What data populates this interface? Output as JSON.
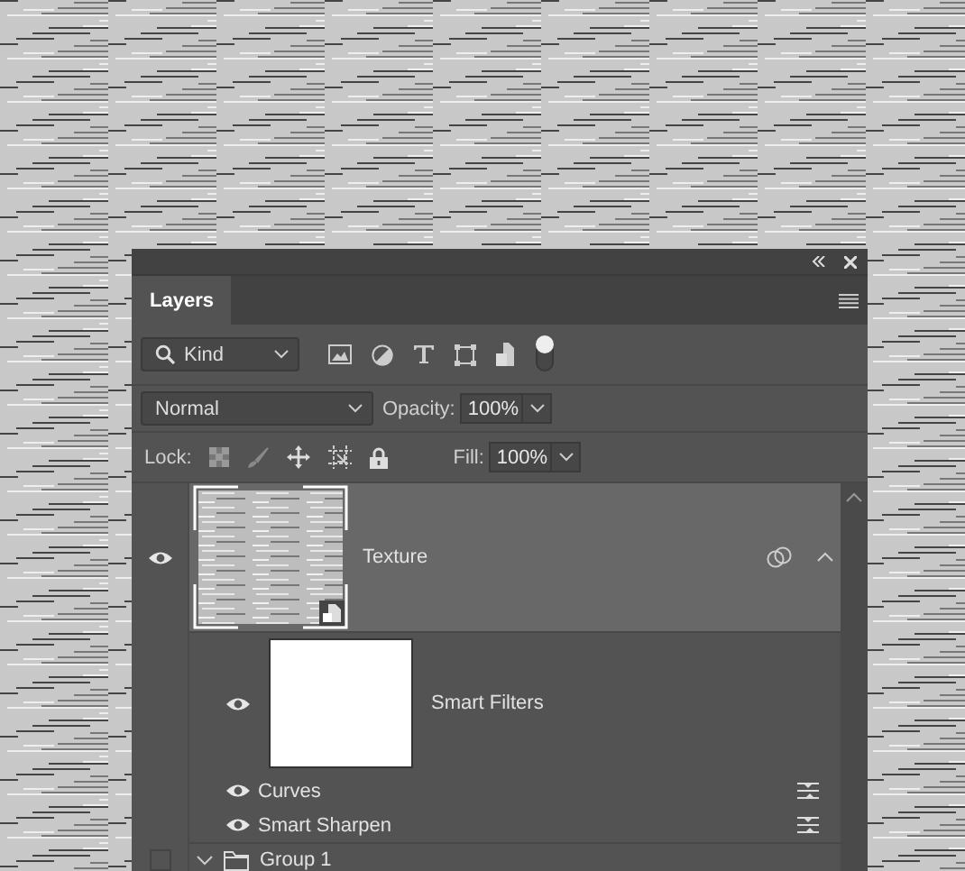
{
  "panel": {
    "tabs": [
      {
        "label": "Layers",
        "selected": true
      }
    ],
    "filter": {
      "value": "Kind",
      "filter_on": true
    },
    "blend_mode": {
      "value": "Normal"
    },
    "opacity": {
      "label": "Opacity:",
      "value": "100%"
    },
    "lock": {
      "label": "Lock:"
    },
    "fill": {
      "label": "Fill:",
      "value": "100%"
    },
    "layers": [
      {
        "kind": "smart_object",
        "name": "Texture",
        "visible": true,
        "selected": true,
        "expanded": true,
        "children": [
          {
            "kind": "smart_filters",
            "name": "Smart Filters",
            "visible": true,
            "children": [
              {
                "kind": "filter",
                "name": "Curves",
                "visible": true
              },
              {
                "kind": "filter",
                "name": "Smart Sharpen",
                "visible": true
              }
            ]
          }
        ]
      },
      {
        "kind": "group",
        "name": "Group 1",
        "visible": false,
        "expanded": true
      }
    ]
  }
}
